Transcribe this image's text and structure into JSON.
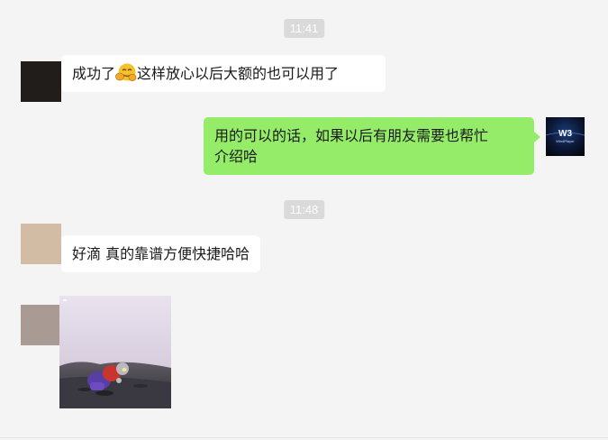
{
  "chat": {
    "time1": "11:41",
    "msg1_before": "成功了",
    "msg1_emoji": "hugging-face-emoji",
    "msg1_after": "这样放心以后大额的也可以用了",
    "msg2_line1": "用的可以的话，如果以后有朋友需要也帮忙",
    "msg2_line2": "介绍哈",
    "avatar_brand": "WindPlayer",
    "time2": "11:48",
    "msg3": "好滴 真的靠谱方便快捷哈哈",
    "image_message": "ultraman-sticker-image"
  },
  "colors": {
    "background": "#f4f4f4",
    "bubble_sent": "#95ec69",
    "bubble_received": "#ffffff",
    "timestamp_bg": "#dadada"
  }
}
